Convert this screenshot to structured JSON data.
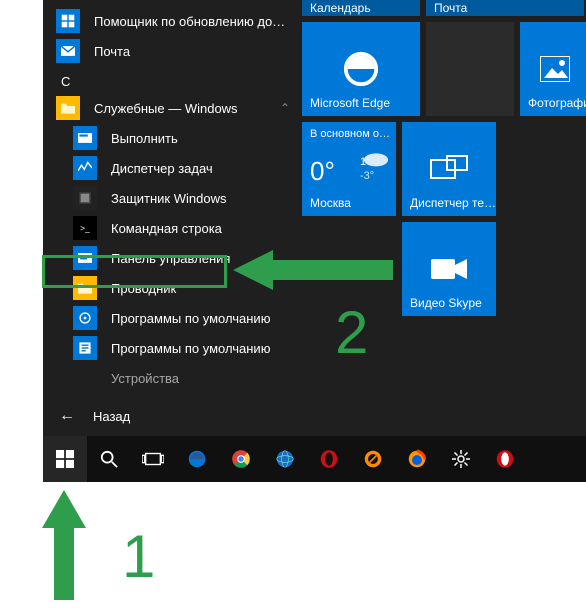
{
  "applist": {
    "top": [
      {
        "label": "Помощник по обновлению до…",
        "icon": "win-update"
      },
      {
        "label": "Почта",
        "icon": "mail"
      }
    ],
    "section_letter": "С",
    "group": {
      "label": "Служебные — Windows",
      "icon": "folder"
    },
    "group_items": [
      {
        "label": "Выполнить",
        "icon": "run"
      },
      {
        "label": "Диспетчер задач",
        "icon": "taskmgr"
      },
      {
        "label": "Защитник Windows",
        "icon": "defender"
      },
      {
        "label": "Командная строка",
        "icon": "cmd"
      },
      {
        "label": "Панель управления",
        "icon": "control-panel"
      },
      {
        "label": "Проводник",
        "icon": "explorer"
      },
      {
        "label": "Программы по умолчанию",
        "icon": "defaults"
      },
      {
        "label": "Программы по умолчанию",
        "icon": "defaults2"
      },
      {
        "label": "Устройства",
        "icon": "devices"
      }
    ],
    "back_label": "Назад"
  },
  "tiles": {
    "calendar": "Календарь",
    "mail": "Почта",
    "edge": "Microsoft Edge",
    "photos": "Фотографии",
    "weather_top": "В основном о…",
    "weather_temp": "0°",
    "weather_hi": "1°",
    "weather_lo": "-3°",
    "weather_city": "Москва",
    "connect": "Диспетчер те…",
    "skype": "Видео Skype"
  },
  "taskbar_icons": [
    "start",
    "search",
    "taskview",
    "edge",
    "chrome",
    "globe",
    "opera",
    "blender",
    "firefox",
    "settings",
    "opera2"
  ],
  "annotations": {
    "num1": "1",
    "num2": "2"
  },
  "colors": {
    "accent": "#0078d7",
    "hl": "#2e9e4d"
  }
}
